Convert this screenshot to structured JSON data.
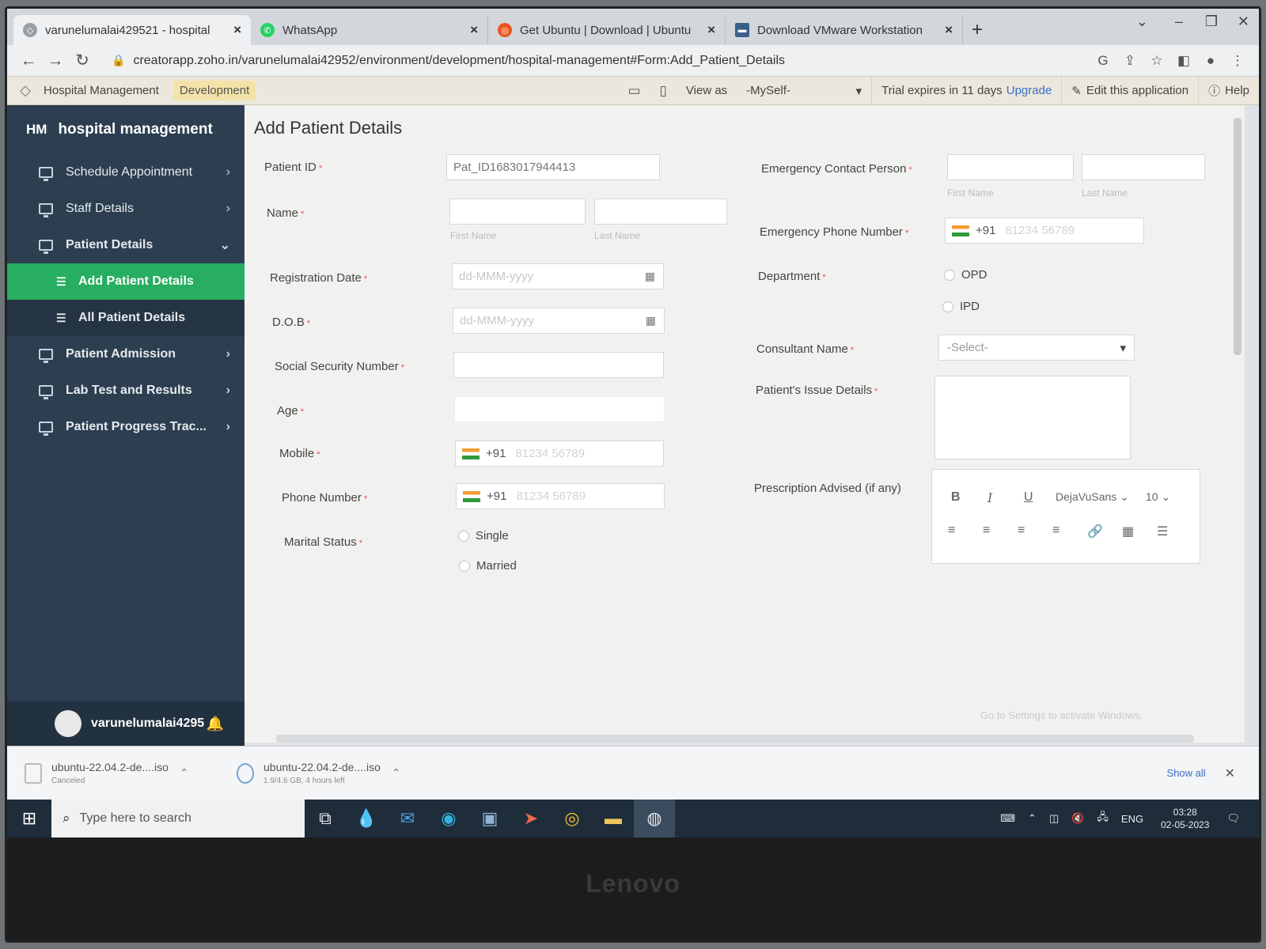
{
  "browser": {
    "tabs": [
      {
        "title": "varunelumalai429521 - hospital",
        "icon": "zoho-icon",
        "color": "#888888"
      },
      {
        "title": "WhatsApp",
        "icon": "whatsapp-icon",
        "color": "#25d366"
      },
      {
        "title": "Get Ubuntu | Download | Ubuntu",
        "icon": "ubuntu-icon",
        "color": "#e95420"
      },
      {
        "title": "Download VMware Workstation",
        "icon": "vmware-icon",
        "color": "#3a5f8a"
      }
    ],
    "url": "creatorapp.zoho.in/varunelumalai42952/environment/development/hospital-management#Form:Add_Patient_Details"
  },
  "appbar": {
    "app_name": "Hospital Management",
    "env_badge": "Development",
    "view_as_label": "View as",
    "view_as_value": "-MySelf-",
    "trial_text": "Trial expires in 11 days",
    "upgrade_label": "Upgrade",
    "edit_label": "Edit this application",
    "help_label": "Help"
  },
  "sidebar": {
    "logo": "HM",
    "title": "hospital management",
    "items": [
      {
        "label": "Schedule Appointment"
      },
      {
        "label": "Staff Details"
      },
      {
        "label": "Patient Details"
      },
      {
        "label": "Patient Admission"
      },
      {
        "label": "Lab Test and Results"
      },
      {
        "label": "Patient Progress Trac..."
      }
    ],
    "subitems": [
      {
        "label": "Add Patient Details"
      },
      {
        "label": "All Patient Details"
      }
    ],
    "user": "varunelumalai4295"
  },
  "form": {
    "title": "Add Patient Details",
    "patient_id_label": "Patient ID",
    "patient_id_value": "Pat_ID1683017944413",
    "name_label": "Name",
    "first_name": "First Name",
    "last_name": "Last Name",
    "registration_label": "Registration Date",
    "date_placeholder": "dd-MMM-yyyy",
    "dob_label": "D.O.B",
    "ssn_label": "Social Security Number",
    "age_label": "Age",
    "mobile_label": "Mobile",
    "phone_label": "Phone Number",
    "country_code": "+91",
    "phone_placeholder": "81234 56789",
    "marital_label": "Marital Status",
    "marital_options": [
      "Single",
      "Married"
    ],
    "emergency_contact_label": "Emergency Contact Person",
    "emergency_phone_label": "Emergency Phone Number",
    "department_label": "Department",
    "department_options": [
      "OPD",
      "IPD"
    ],
    "consultant_label": "Consultant Name",
    "consultant_placeholder": "-Select-",
    "issue_label": "Patient's Issue Details",
    "prescription_label": "Prescription Advised (if any)",
    "editor_font": "DejaVuSans",
    "editor_size": "10",
    "watermark": "Go to Settings to activate Windows."
  },
  "downloads": {
    "items": [
      {
        "name": "ubuntu-22.04.2-de....iso",
        "status": "Canceled"
      },
      {
        "name": "ubuntu-22.04.2-de....iso",
        "status": "1.9/4.6 GB, 4 hours left"
      }
    ],
    "show_all": "Show all"
  },
  "taskbar": {
    "search_placeholder": "Type here to search",
    "lang": "ENG",
    "time": "03:28",
    "date": "02-05-2023"
  },
  "monitor_brand": "Lenovo"
}
